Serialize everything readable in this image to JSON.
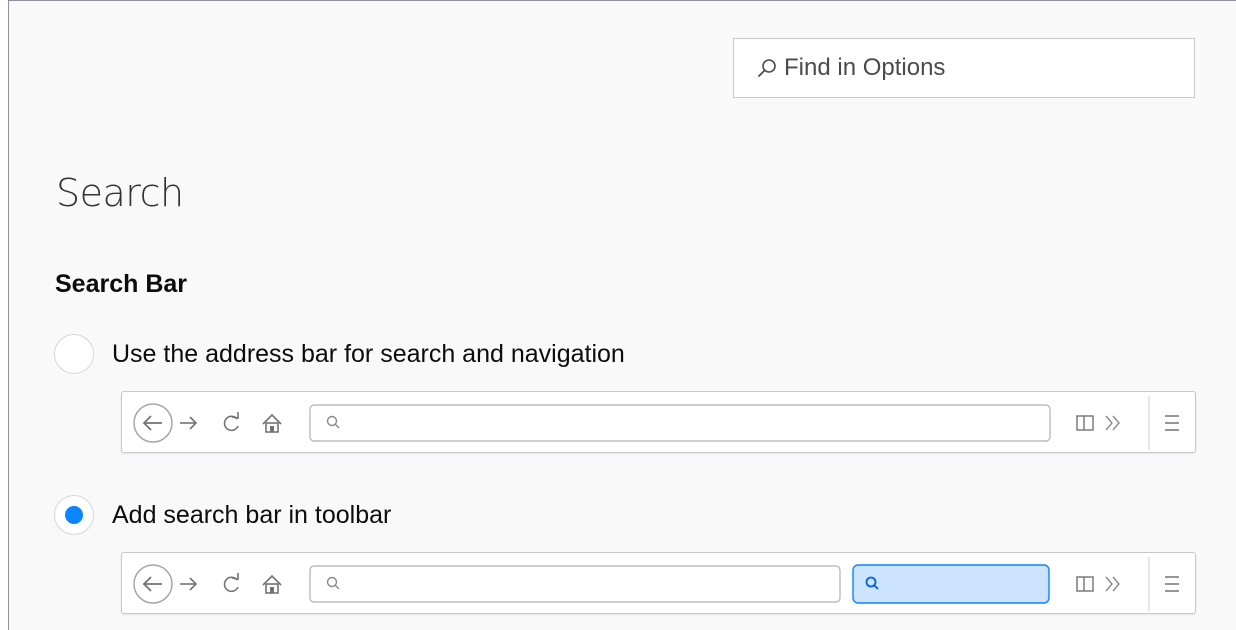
{
  "find": {
    "placeholder": "Find in Options",
    "icon": "search-icon"
  },
  "page": {
    "title": "Search"
  },
  "search_bar": {
    "heading": "Search Bar",
    "options": [
      {
        "label": "Use the address bar for search and navigation",
        "selected": false
      },
      {
        "label": "Add search bar in toolbar",
        "selected": true
      }
    ]
  },
  "toolbar_icons": [
    "back-arrow-icon",
    "forward-arrow-icon",
    "reload-icon",
    "home-icon",
    "search-icon",
    "sidebar-icon",
    "overflow-chevrons-icon",
    "hamburger-menu-icon"
  ],
  "colors": {
    "accent": "#0a84ff",
    "search_highlight_bg": "#cce4ff",
    "search_highlight_border": "#0a84ff"
  }
}
